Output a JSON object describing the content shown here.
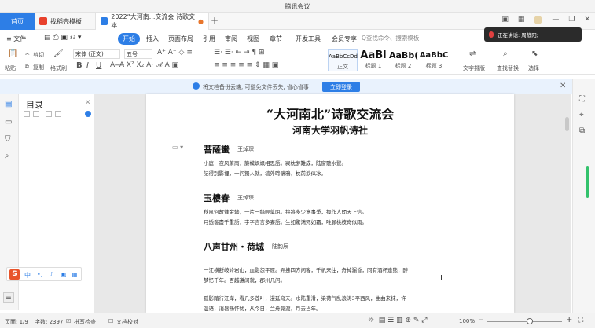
{
  "window": {
    "title": "腾讯会议"
  },
  "tabs": {
    "home": "首页",
    "items": [
      {
        "label": "找稻壳模板"
      },
      {
        "label": "2022“大河南...交流会 诗歌文本"
      }
    ]
  },
  "menu": {
    "file": "≡ 文件",
    "items": [
      "开始",
      "插入",
      "页面布局",
      "引用",
      "审阅",
      "视图",
      "章节",
      "开发工具",
      "会员专享"
    ],
    "active": "开始",
    "search_placeholder": "Q查找命令、搜索模板"
  },
  "speaker": {
    "text": "正在讲话: 周静阳;"
  },
  "ribbon": {
    "paste": "粘贴",
    "cut": "剪切",
    "copy": "复制",
    "format_painter": "格式刷",
    "font_name": "宋体 (正文)",
    "font_size": "五号",
    "styles": [
      {
        "sample": "AaBbCcDd",
        "label": "正文"
      },
      {
        "sample": "AaBl",
        "label": "标题 1"
      },
      {
        "sample": "AaBb(",
        "label": "标题 2"
      },
      {
        "sample": "AaBbC",
        "label": "标题 3"
      }
    ],
    "text_layout": "文字排版",
    "find_replace": "查找替换",
    "select": "选择"
  },
  "notice": {
    "text": "将文档备份云端, 可避免文件丢失, 省心省事",
    "button": "立即登录"
  },
  "outline": {
    "title": "目录"
  },
  "ime": {
    "lang": "中",
    "punct": "•,",
    "mic": "🎤"
  },
  "document": {
    "title": "“大河南北”诗歌交流会",
    "subtitle": "河南大学羽帆诗社",
    "poems": [
      {
        "title": "菩薩蠻",
        "author": "王焯琛",
        "lines": [
          "小庭一夜风萧雨，簾幙飒飒相思語。寂枕夢難成，陆窗聽水聲。",
          "記得別影裡，一问獨人就，墙外啼鵑鴉，枕前淚似冰。"
        ]
      },
      {
        "title": "玉樓春",
        "author": "王焯琛",
        "lines": [
          "秋風何故催金燼，一片一絲輕莫阻。拚將多少意事爭，換作人間天上信。",
          "月透發盡千重語，字字言言多妄語。生如驚鴻死如霜，唯願桃枝寄似雨。"
        ]
      },
      {
        "title": "八声甘州・荷城",
        "author": "陆韵辰",
        "lines": [
          "一江横断岐岭岩山，血影怨平原。弄拂四方闲客，千帆来往，舟棹漏昏，同有酒杯逢熊，醉",
          "梦忆千年。百越遵阔就，郡州几问。",
          "孤影踏行江岸，看几多莲叶，漫延穹天。水陆重滑，染荷气乱浪涛3平西风，曲曲来抹，许",
          "温语，消暑畅怀忧，从今日，兰舟竟渡，月去当年。"
        ]
      }
    ]
  },
  "status": {
    "page": "页面: 1/9",
    "words": "字数: 2397",
    "spell": "拼写检查",
    "proofread": "文档校对",
    "zoom": "100%"
  }
}
